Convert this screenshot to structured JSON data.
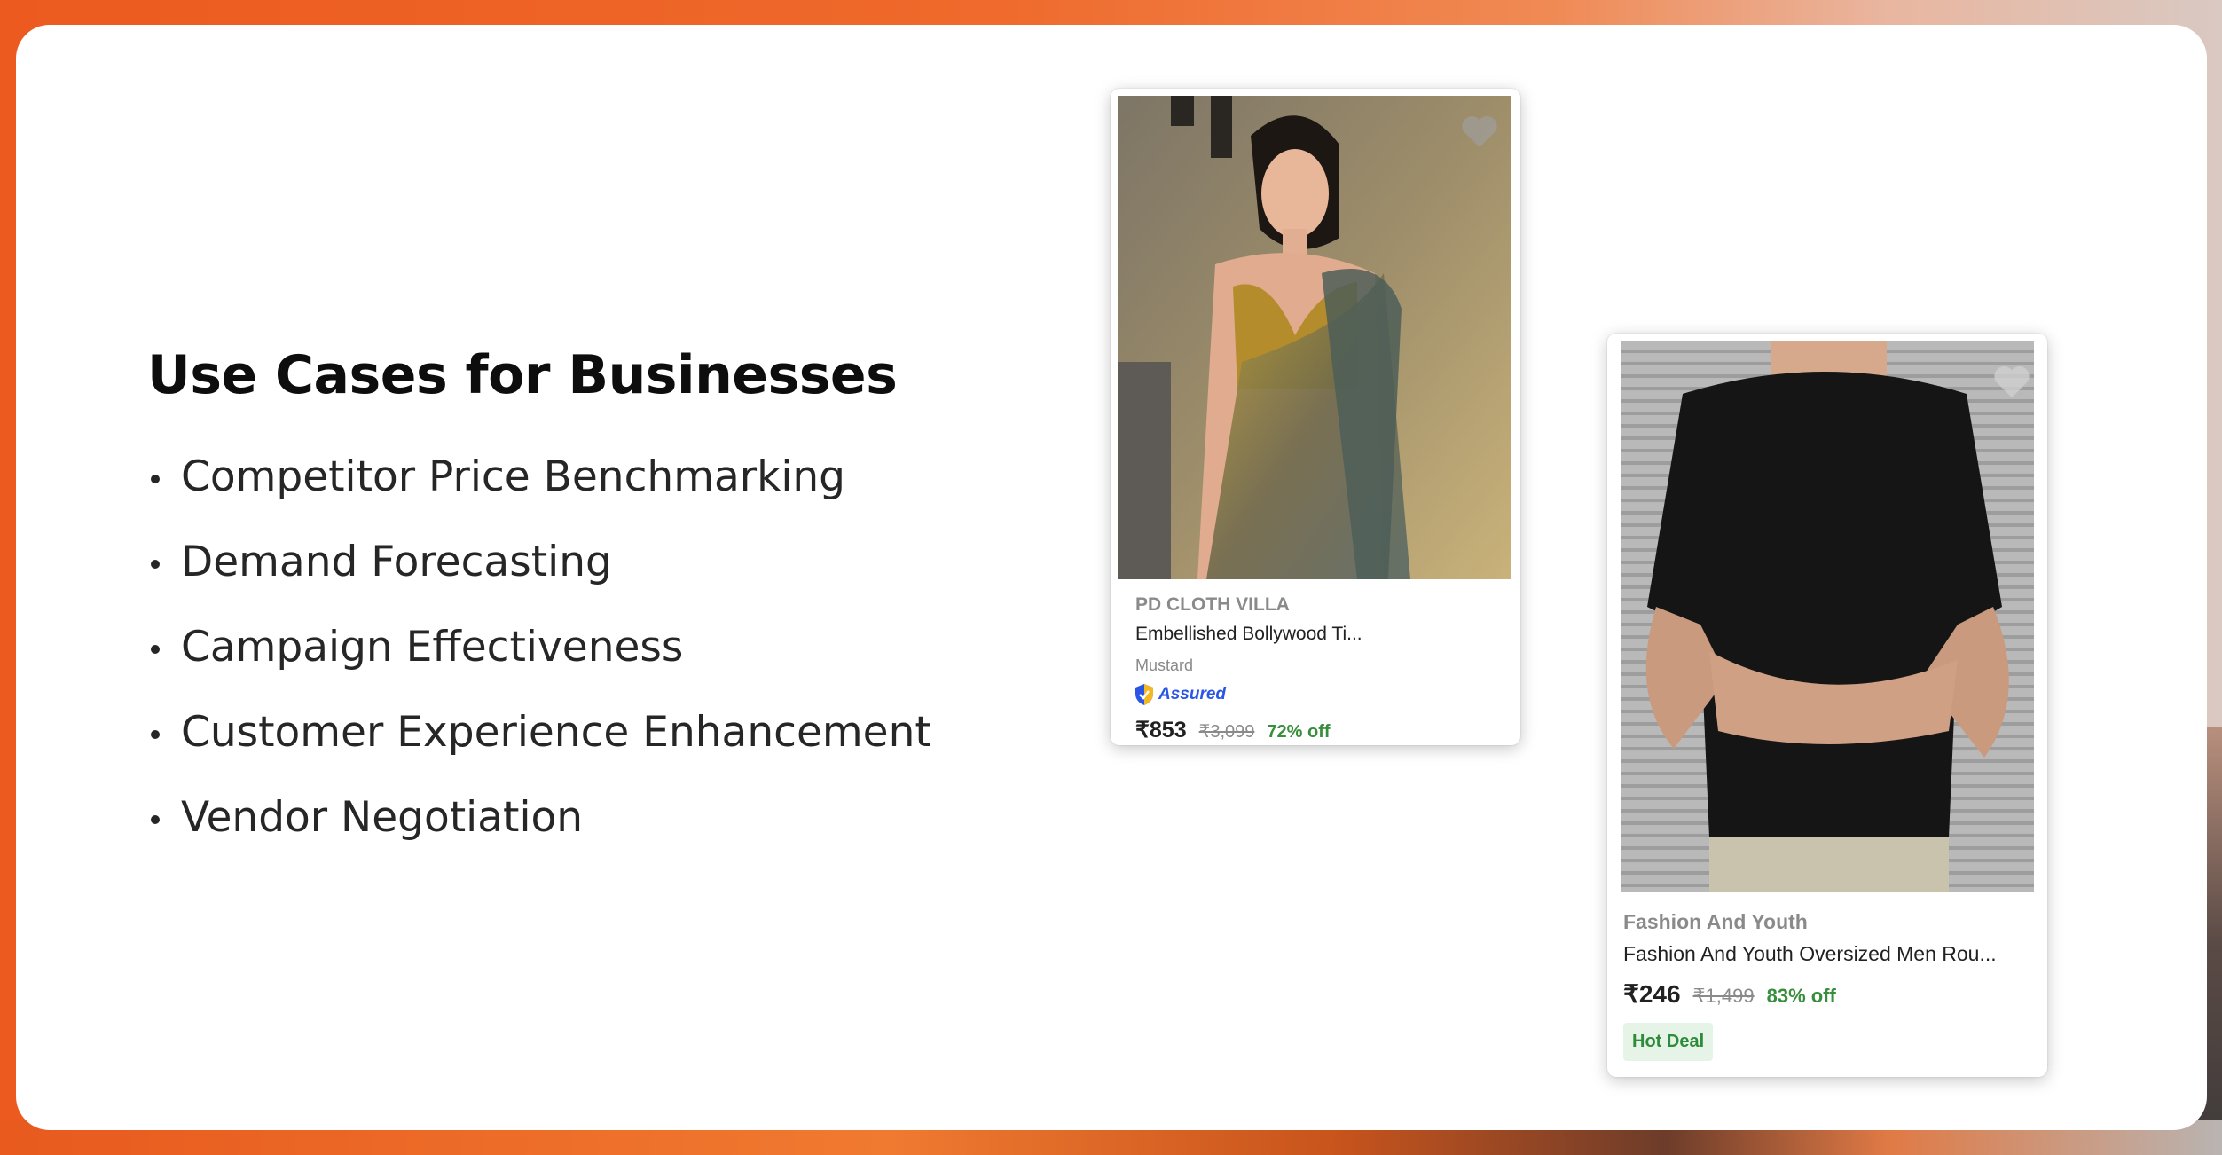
{
  "heading": "Use Cases for Businesses",
  "use_cases": [
    "Competitor Price Benchmarking",
    "Demand Forecasting",
    "Campaign Effectiveness",
    "Customer Experience Enhancement",
    "Vendor Negotiation"
  ],
  "products": [
    {
      "brand": "PD CLOTH VILLA",
      "name": "Embellished Bollywood Ti...",
      "color": "Mustard",
      "badge": "Assured",
      "price": "₹853",
      "mrp": "₹3,099",
      "discount": "72% off"
    },
    {
      "brand": "Fashion And Youth",
      "name": "Fashion And Youth Oversized Men Rou...",
      "price": "₹246",
      "mrp": "₹1,499",
      "discount": "83% off",
      "tag": "Hot Deal"
    }
  ],
  "icons": {
    "wishlist": "heart-icon",
    "assured": "shield-check-icon"
  },
  "colors": {
    "background_orange": "#ec5a1f",
    "discount_green": "#388e3c",
    "assured_blue": "#2a55e5"
  }
}
